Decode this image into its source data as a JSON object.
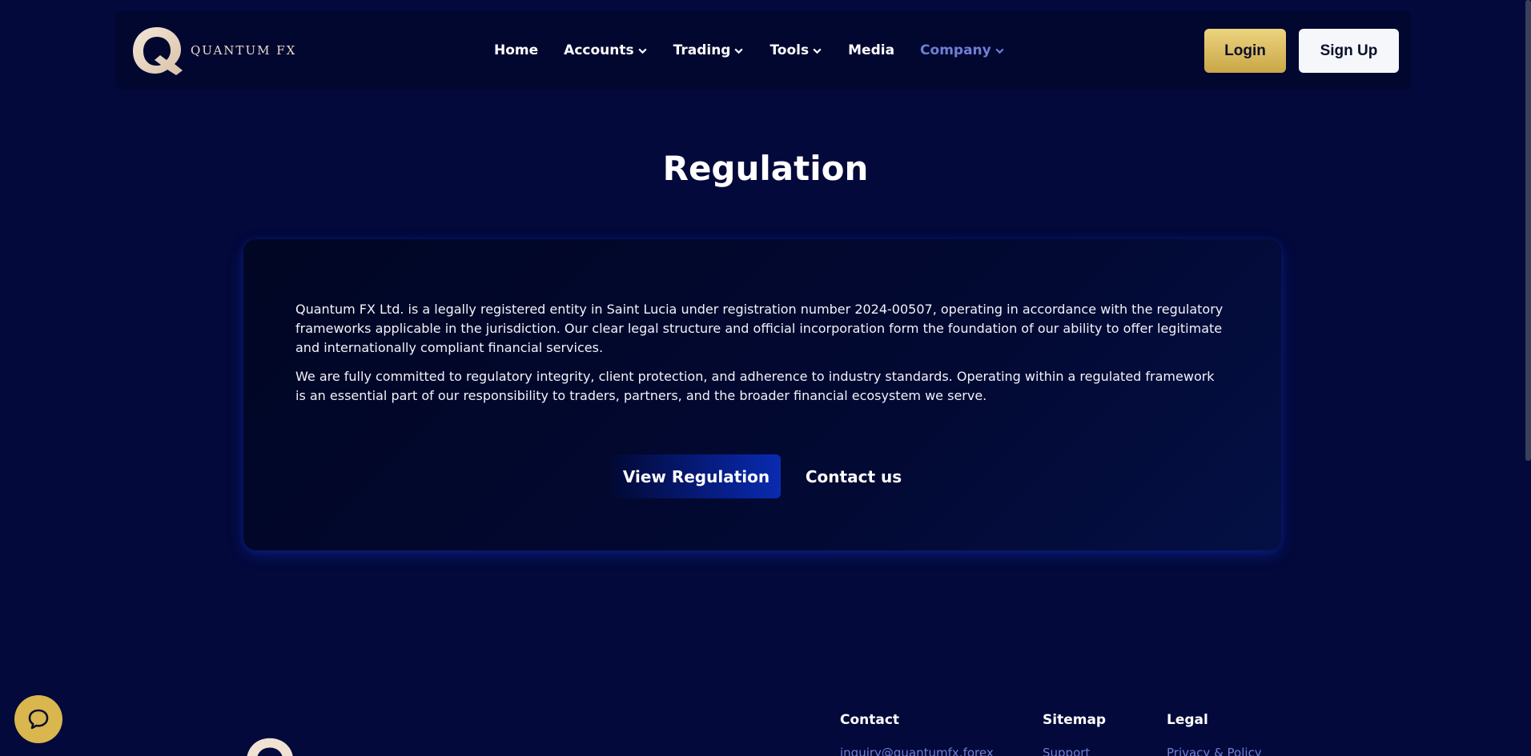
{
  "brand": {
    "name": "QUANTUM FX",
    "logo_icon": "q-logo-icon"
  },
  "nav": {
    "items": [
      {
        "label": "Home",
        "has_dropdown": false
      },
      {
        "label": "Accounts",
        "has_dropdown": true
      },
      {
        "label": "Trading",
        "has_dropdown": true
      },
      {
        "label": "Tools",
        "has_dropdown": true
      },
      {
        "label": "Media",
        "has_dropdown": false
      },
      {
        "label": "Company",
        "has_dropdown": true,
        "active": true
      }
    ],
    "login_label": "Login",
    "signup_label": "Sign Up"
  },
  "page": {
    "title": "Regulation",
    "paragraphs": [
      "Quantum FX Ltd. is a legally registered entity in Saint Lucia under registration number 2024-00507, operating in accordance with the regulatory frameworks applicable in the jurisdiction. Our clear legal structure and official incorporation form the foundation of our ability to offer legitimate and internationally compliant financial services.",
      "We are fully committed to regulatory integrity, client protection, and adherence to industry standards. Operating within a regulated framework is an essential part of our responsibility to traders, partners, and the broader financial ecosystem we serve."
    ],
    "view_regulation_label": "View Regulation",
    "contact_label": "Contact us"
  },
  "footer": {
    "contact": {
      "heading": "Contact",
      "link": "inquiry@quantumfx.forex"
    },
    "sitemap": {
      "heading": "Sitemap",
      "link": "Support"
    },
    "legal": {
      "heading": "Legal",
      "link": "Privacy & Policy"
    }
  },
  "chat": {
    "icon": "chat-bubble-icon"
  },
  "colors": {
    "background": "#03093a",
    "accent_gold": "#d9b64e",
    "active_nav": "#6f7fd4",
    "button_blue": "#07208f"
  }
}
